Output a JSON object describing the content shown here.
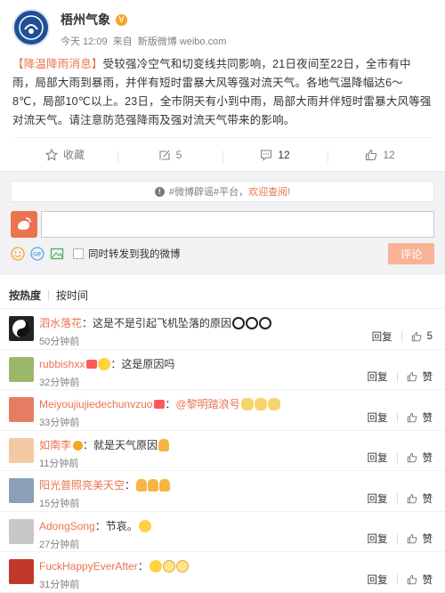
{
  "post": {
    "author": "梧州气象",
    "time": "今天 12:09",
    "source_prefix": "来自",
    "source": "新版微博 weibo.com",
    "topic": "【降温降雨消息】",
    "body": "受较强冷空气和切变线共同影响，21日夜间至22日，全市有中雨，局部大雨到暴雨，并伴有短时雷暴大风等强对流天气。各地气温降幅达6～8℃，局部10℃以上。23日，全市阴天有小到中雨，局部大雨并伴短时雷暴大风等强对流天气。请注意防范强降雨及强对流天气带来的影响。"
  },
  "actions": {
    "favorite": "收藏",
    "forward": "5",
    "comment": "12",
    "like": "12"
  },
  "comment_area": {
    "notice_prefix": "#微博辟谣#平台，",
    "notice_link": "欢迎查阅!",
    "forward_label": "同时转发到我的微博",
    "submit_label": "评论"
  },
  "sort": {
    "hot": "按热度",
    "time": "按时间"
  },
  "comments": [
    {
      "user": "泗水落花",
      "text": "：这是不是引起飞机坠落的原因",
      "time": "50分钟前",
      "reply": "回复",
      "like": "5"
    },
    {
      "user": "rubbishxx",
      "text": "：这是原因吗",
      "time": "32分钟前",
      "reply": "回复",
      "like": "赞"
    },
    {
      "user": "Meiyoujiujiedechunvzuo",
      "text": "：",
      "mention": "@黎明踏浪号",
      "time": "33分钟前",
      "reply": "回复",
      "like": "赞"
    },
    {
      "user": "如南李",
      "text": "：就是天气原因",
      "time": "11分钟前",
      "reply": "回复",
      "like": "赞"
    },
    {
      "user": "阳光普照亮美天空",
      "text": "：",
      "time": "15分钟前",
      "reply": "回复",
      "like": "赞"
    },
    {
      "user": "AdongSong",
      "text": "：节哀。",
      "time": "27分钟前",
      "reply": "回复",
      "like": "赞"
    },
    {
      "user": "FuckHappyEverAfter",
      "text": "：",
      "time": "31分钟前",
      "reply": "回复",
      "like": "赞"
    }
  ],
  "colors": {
    "accent": "#eb7350",
    "muted": "#808080",
    "verified": "#f5a623",
    "submit": "#f9b399"
  }
}
